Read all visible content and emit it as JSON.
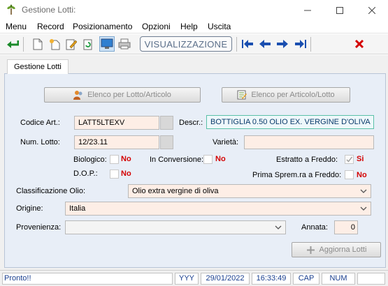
{
  "window": {
    "title": "Gestione Lotti:"
  },
  "menu": [
    "Menu",
    "Record",
    "Posizionamento",
    "Opzioni",
    "Help",
    "Uscita"
  ],
  "toolbar": {
    "mode_label": "VISUALIZZAZIONE"
  },
  "tab": {
    "label": "Gestione Lotti"
  },
  "form": {
    "btn_elenco_lotto": "Elenco per Lotto/Articolo",
    "btn_elenco_articolo": "Elenco per Articolo/Lotto",
    "codice_label": "Codice Art.:",
    "codice_value": "LATT5LTEXV",
    "descr_label": "Descr.:",
    "descr_value": "BOTTIGLIA 0.50 OLIO EX. VERGINE D'OLIVA",
    "num_lotto_label": "Num. Lotto:",
    "num_lotto_value": "12/23.11",
    "varieta_label": "Varietà:",
    "varieta_value": "",
    "biologico_label": "Biologico:",
    "biologico_value": "No",
    "conversione_label": "In Conversione:",
    "conversione_value": "No",
    "estratto_label": "Estratto a Freddo:",
    "estratto_value": "Si",
    "dop_label": "D.O.P.:",
    "dop_value": "No",
    "prima_label": "Prima Sprem.ra a Freddo:",
    "prima_value": "No",
    "classificazione_label": "Classificazione Olio:",
    "classificazione_value": "Olio extra vergine di oliva",
    "origine_label": "Origine:",
    "origine_value": "Italia",
    "provenienza_label": "Provenienza:",
    "provenienza_value": "",
    "annata_label": "Annata:",
    "annata_value": "0",
    "aggiorna_label": "Aggiorna Lotti"
  },
  "status": {
    "message": "Pronto!!",
    "cells": [
      "YYY",
      "29/01/2022",
      "16:33:49",
      "CAP",
      "NUM"
    ]
  },
  "colors": {
    "required_red": "#d40000",
    "panel_bg": "#e8eef7",
    "field_bg": "#fdeee6"
  }
}
